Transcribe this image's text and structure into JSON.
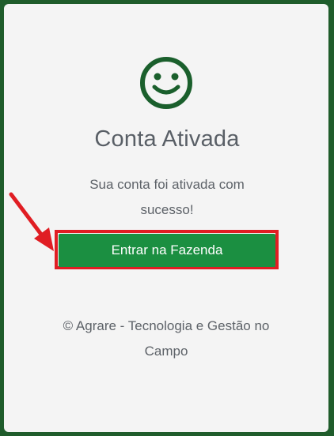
{
  "card": {
    "title": "Conta Ativada",
    "message": "Sua conta foi ativada com sucesso!",
    "button_label": "Entrar na Fazenda",
    "footer": "© Agrare - Tecnologia e Gestão no Campo"
  },
  "icons": {
    "status_icon": "smiley-face-icon",
    "annotation": "red-arrow-icon"
  },
  "colors": {
    "background_border": "#1f5c2b",
    "card_background": "#f4f4f4",
    "smiley": "#1a5f2c",
    "button": "#1b8f41",
    "highlight": "#e01d23",
    "text": "#5d6268"
  }
}
